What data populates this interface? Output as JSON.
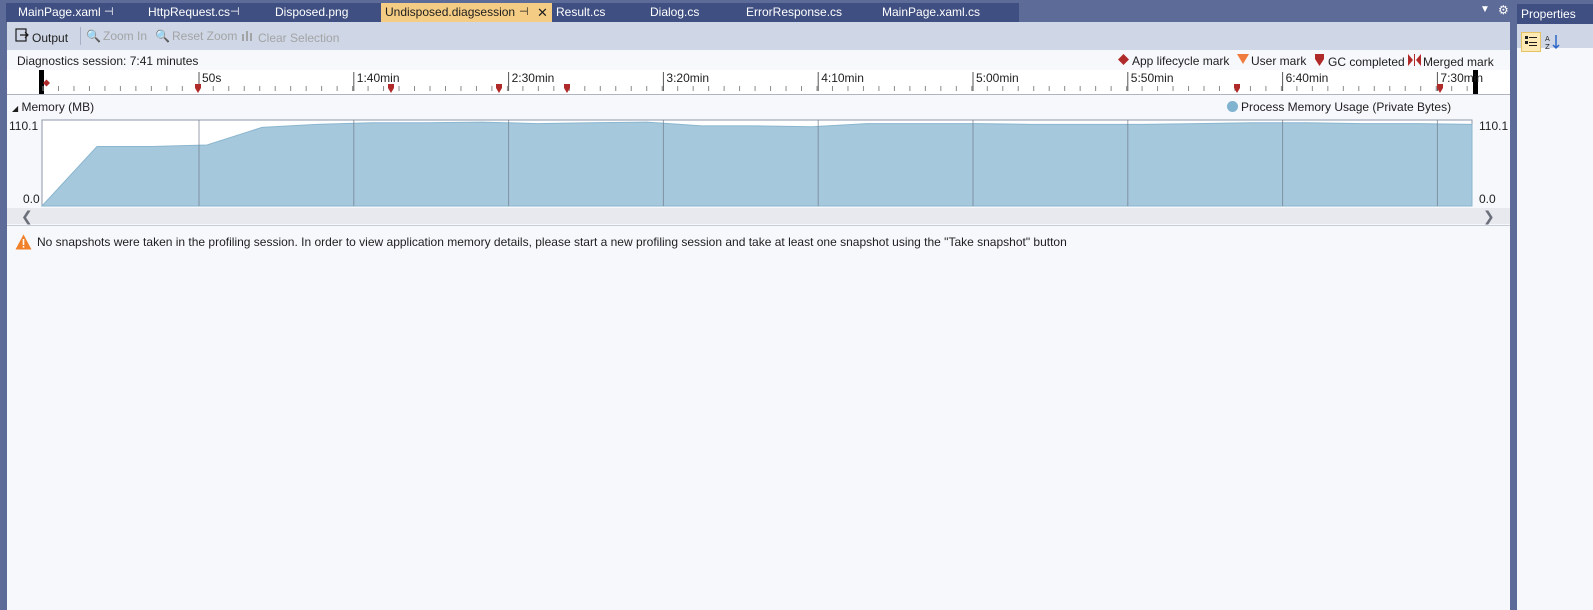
{
  "tabs": [
    {
      "label": "MainPage.xaml",
      "pinned": true,
      "active": false
    },
    {
      "label": "HttpRequest.cs",
      "pinned": true,
      "active": false
    },
    {
      "label": "Disposed.png",
      "pinned": false,
      "active": false
    },
    {
      "label": "Undisposed.diagsession",
      "pinned": true,
      "active": true
    },
    {
      "label": "Result.cs",
      "pinned": false,
      "active": false
    },
    {
      "label": "Dialog.cs",
      "pinned": false,
      "active": false
    },
    {
      "label": "ErrorResponse.cs",
      "pinned": false,
      "active": false
    },
    {
      "label": "MainPage.xaml.cs",
      "pinned": false,
      "active": false
    }
  ],
  "toolbar": {
    "output_label": "Output",
    "zoom_in_label": "Zoom In",
    "reset_zoom_label": "Reset Zoom",
    "clear_selection_label": "Clear Selection"
  },
  "session": {
    "title": "Diagnostics session: 7:41 minutes"
  },
  "legend": {
    "app_lifecycle": "App lifecycle mark",
    "user_mark": "User mark",
    "gc_completed": "GC completed",
    "merged_mark": "Merged mark"
  },
  "ruler": {
    "labels": [
      "50s",
      "1:40min",
      "2:30min",
      "3:20min",
      "4:10min",
      "5:00min",
      "5:50min",
      "6:40min",
      "7:30min"
    ]
  },
  "memory": {
    "title": "Memory (MB)",
    "legend": "Process Memory Usage (Private Bytes)",
    "y_max_label": "110.1",
    "y_min_label": "0.0"
  },
  "notice": {
    "text": "No snapshots were taken in the profiling session. In order to view application memory details, please start a new profiling session and take at least one snapshot using the \"Take snapshot\" button"
  },
  "properties": {
    "title": "Properties"
  },
  "colors": {
    "tab_bg": "#3f4f81",
    "tab_active": "#f5cc84",
    "chrome": "#5d6b99",
    "memory_fill": "#a6c8dc",
    "mark_red": "#c0392b",
    "user_mark": "#f07b3f"
  },
  "chart_data": {
    "type": "area",
    "title": "Memory (MB)",
    "series": [
      {
        "name": "Process Memory Usage (Private Bytes)"
      }
    ],
    "x": [
      "0s",
      "10s",
      "20s",
      "30s",
      "40s",
      "50s",
      "1:00",
      "1:20",
      "1:40",
      "2:00",
      "2:10",
      "2:30",
      "2:50",
      "3:00",
      "3:20",
      "3:40",
      "4:00",
      "4:10",
      "4:30",
      "5:00",
      "5:30",
      "5:50",
      "6:10",
      "6:40",
      "7:00",
      "7:30",
      "7:41"
    ],
    "values": [
      0,
      78,
      78,
      80,
      103,
      107,
      109,
      109,
      110,
      108,
      109,
      110,
      105,
      105,
      104,
      108,
      108,
      108,
      107,
      107,
      107,
      108,
      109,
      109,
      108,
      108,
      107
    ],
    "ylim": [
      0,
      110.1
    ]
  }
}
